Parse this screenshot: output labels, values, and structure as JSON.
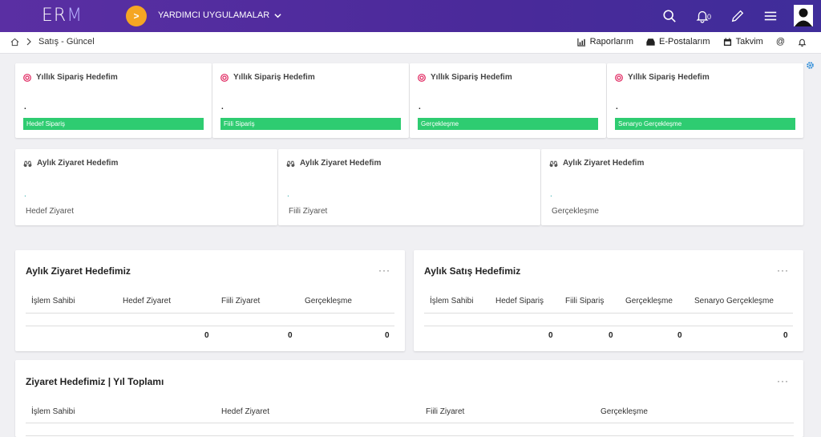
{
  "topbar": {
    "logo_main": "ER",
    "logo_accent": "M",
    "apps_label": "YARDIMCI UYGULAMALAR",
    "notification_count": "0",
    "colors": {
      "bar_start": "#5a2fa3",
      "bar_end": "#3f2d9a",
      "accent": "#f5a623"
    }
  },
  "breadcrumb": {
    "current": "Satış - Güncel"
  },
  "actions": {
    "reports": "Raporlarım",
    "emails": "E-Postalarım",
    "calendar": "Takvim"
  },
  "kpi_cards": [
    {
      "title": "Yıllık Sipariş Hedefim",
      "value": ".",
      "bar_label": "Hedef Sipariş"
    },
    {
      "title": "Yıllık Sipariş Hedefim",
      "value": ".",
      "bar_label": "Fiili Sipariş"
    },
    {
      "title": "Yıllık Sipariş Hedefim",
      "value": ".",
      "bar_label": "Gerçekleşme"
    },
    {
      "title": "Yıllık Sipariş Hedefim",
      "value": ".",
      "bar_label": "Senaryo Gerçekleşme"
    }
  ],
  "visit_cards": [
    {
      "title": "Aylık Ziyaret Hedefim",
      "value": ".",
      "label": "Hedef Ziyaret"
    },
    {
      "title": "Aylık Ziyaret Hedefim",
      "value": ".",
      "label": "Fiili Ziyaret"
    },
    {
      "title": "Aylık Ziyaret Hedefim",
      "value": ".",
      "label": "Gerçekleşme"
    }
  ],
  "visit_table": {
    "title": "Aylık Ziyaret Hedefimiz",
    "more": "···",
    "columns": [
      "İşlem Sahibi",
      "Hedef Ziyaret",
      "Fiili Ziyaret",
      "Gerçekleşme"
    ],
    "totals": [
      "0",
      "0",
      "0"
    ]
  },
  "sales_table": {
    "title": "Aylık Satış Hedefimiz",
    "more": "···",
    "columns": [
      "İşlem Sahibi",
      "Hedef Sipariş",
      "Fiili Sipariş",
      "Gerçekleşme",
      "Senaryo Gerçekleşme"
    ],
    "totals": [
      "0",
      "0",
      "0",
      "0"
    ]
  },
  "year_table": {
    "title": "Ziyaret Hedefimiz | Yıl Toplamı",
    "more": "···",
    "columns": [
      "İşlem Sahibi",
      "Hedef Ziyaret",
      "Fiili Ziyaret",
      "Gerçekleşme"
    ]
  },
  "status_colors": {
    "green_bar": "#2ecc71",
    "teal_dot": "#1aa3a3",
    "target_icon": "#e0245e",
    "gear_icon": "#2a8bd8"
  }
}
